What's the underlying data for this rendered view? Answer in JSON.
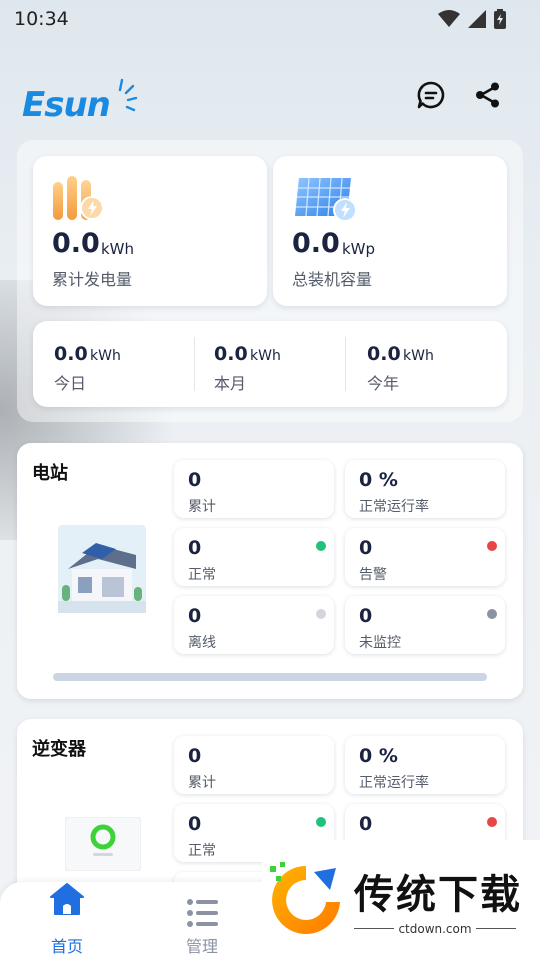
{
  "status_bar": {
    "time": "10:34"
  },
  "header": {
    "logo_text": "Esun",
    "icons": [
      "message-icon",
      "share-icon"
    ]
  },
  "summary": {
    "total_generation": {
      "value": "0.0",
      "unit": "kWh",
      "label": "累计发电量"
    },
    "installed_capacity": {
      "value": "0.0",
      "unit": "kWp",
      "label": "总装机容量"
    },
    "periods": [
      {
        "value": "0.0",
        "unit": "kWh",
        "label": "今日"
      },
      {
        "value": "0.0",
        "unit": "kWh",
        "label": "本月"
      },
      {
        "value": "0.0",
        "unit": "kWh",
        "label": "今年"
      }
    ]
  },
  "station": {
    "title": "电站",
    "stats": [
      {
        "value": "0",
        "label": "累计"
      },
      {
        "value": "0 %",
        "label": "正常运行率"
      },
      {
        "value": "0",
        "label": "正常",
        "dot_color": "#1fc27a"
      },
      {
        "value": "0",
        "label": "告警",
        "dot_color": "#e84545"
      },
      {
        "value": "0",
        "label": "离线",
        "dot_color": "#d3d6de"
      },
      {
        "value": "0",
        "label": "未监控",
        "dot_color": "#8b93a3"
      }
    ]
  },
  "inverter": {
    "title": "逆变器",
    "stats": [
      {
        "value": "0",
        "label": "累计"
      },
      {
        "value": "0 %",
        "label": "正常运行率"
      },
      {
        "value": "0",
        "label": "正常",
        "dot_color": "#1fc27a"
      },
      {
        "value": "0",
        "label": "",
        "dot_color": "#e84545"
      }
    ]
  },
  "bottom_nav": {
    "items": [
      {
        "label": "首页",
        "icon": "home-icon",
        "active": true
      },
      {
        "label": "管理",
        "icon": "list-icon",
        "active": false
      }
    ],
    "active_color": "#1f6fe0",
    "inactive_color": "#8b93a3"
  },
  "watermark": {
    "text": "传统下载",
    "url": "ctdown.com"
  },
  "colors": {
    "accent": "#1f6fe0",
    "logo": "#1a8ae0"
  }
}
